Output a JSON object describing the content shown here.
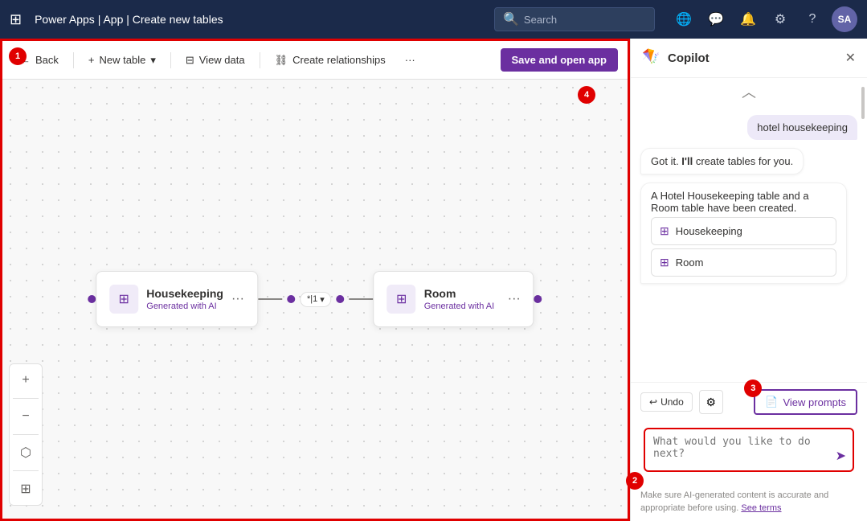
{
  "topbar": {
    "grid_icon": "⊞",
    "title": "Power Apps | App | Create new tables",
    "search_placeholder": "Search",
    "icons": [
      "🌐",
      "💬",
      "🔔",
      "⚙",
      "?"
    ],
    "avatar_text": "SA"
  },
  "toolbar": {
    "back_label": "Back",
    "new_table_label": "New table",
    "view_data_label": "View data",
    "create_relationships_label": "Create relationships",
    "more_label": "···",
    "save_label": "Save and open app"
  },
  "canvas": {
    "step1": "1",
    "step4": "4",
    "cards": [
      {
        "title": "Housekeeping",
        "subtitle": "Generated with AI",
        "icon": "⊞"
      },
      {
        "title": "Room",
        "subtitle": "Generated with AI",
        "icon": "⊞"
      }
    ],
    "connector_label": "*|1",
    "tools": [
      "+",
      "−",
      "⬡",
      "⊞"
    ]
  },
  "copilot": {
    "title": "Copilot",
    "logo": "🪁",
    "close_icon": "✕",
    "messages": [
      {
        "type": "user",
        "text": "hotel housekeeping"
      },
      {
        "type": "bot",
        "text": "Got it. I'll create tables for you."
      },
      {
        "type": "bot",
        "text": "A Hotel Housekeeping table and a Room table have been created.",
        "chips": [
          "Housekeeping",
          "Room"
        ]
      }
    ],
    "undo_label": "Undo",
    "filter_icon": "⚙",
    "view_prompts_label": "View prompts",
    "view_prompts_icon": "📄",
    "step2": "2",
    "step3": "3",
    "input_placeholder": "What would you like to do next?",
    "send_icon": "➤",
    "footer_text": "Make sure AI-generated content is accurate and appropriate before using.",
    "footer_link": "See terms"
  }
}
